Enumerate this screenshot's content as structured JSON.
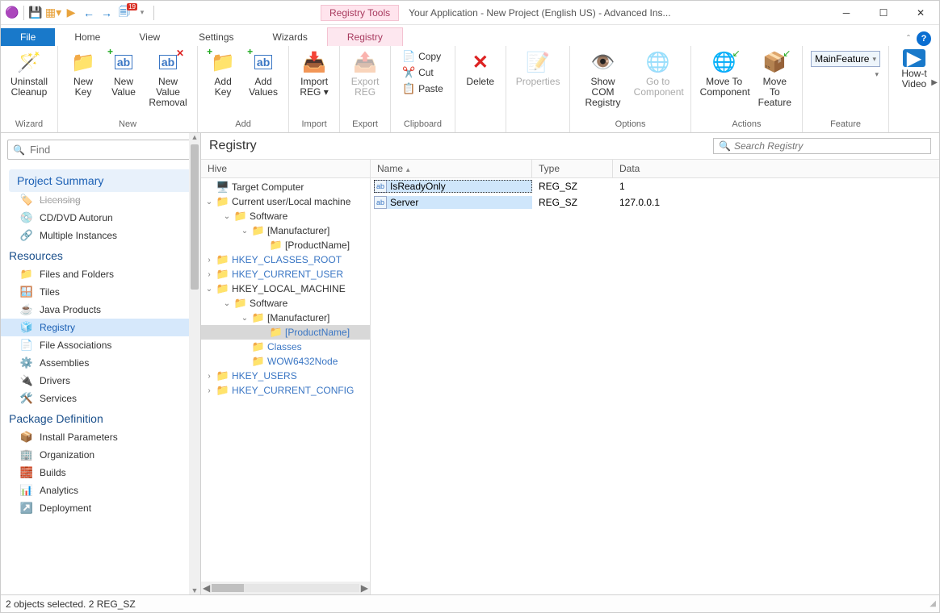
{
  "title": "Your Application - New Project (English US) - Advanced Ins...",
  "regtools_label": "Registry Tools",
  "qat_badge": "19",
  "tabs": [
    "File",
    "Home",
    "View",
    "Settings",
    "Wizards",
    "Registry"
  ],
  "ribbon": {
    "wizard": {
      "label": "Wizard",
      "uninstall": "Uninstall\nCleanup"
    },
    "new": {
      "label": "New",
      "key": "New\nKey",
      "value": "New\nValue",
      "removal": "New Value\nRemoval"
    },
    "add": {
      "label": "Add",
      "key": "Add\nKey",
      "values": "Add\nValues"
    },
    "import": {
      "label": "Import",
      "reg": "Import\nREG ▾"
    },
    "export": {
      "label": "Export",
      "reg": "Export\nREG"
    },
    "clipboard": {
      "label": "Clipboard",
      "copy": "Copy",
      "cut": "Cut",
      "paste": "Paste"
    },
    "delete": "Delete",
    "properties": "Properties",
    "options": {
      "label": "Options",
      "showcom": "Show COM\nRegistry",
      "goto": "Go to\nComponent"
    },
    "actions": {
      "label": "Actions",
      "movecomp": "Move To\nComponent",
      "movefeat": "Move To\nFeature"
    },
    "feature": {
      "label": "Feature",
      "value": "MainFeature"
    },
    "howto": "How-t\nVideo"
  },
  "find_placeholder": "Find",
  "nav": {
    "project_summary": "Project Summary",
    "licensing": "Licensing",
    "items1": [
      "CD/DVD Autorun",
      "Multiple Instances"
    ],
    "resources_hdr": "Resources",
    "resources": [
      "Files and Folders",
      "Tiles",
      "Java Products",
      "Registry",
      "File Associations",
      "Assemblies",
      "Drivers",
      "Services"
    ],
    "pkgdef_hdr": "Package Definition",
    "pkgdef": [
      "Install Parameters",
      "Organization",
      "Builds",
      "Analytics",
      "Deployment"
    ]
  },
  "content": {
    "title": "Registry",
    "search_placeholder": "Search Registry",
    "hive_label": "Hive",
    "cols": [
      "Name",
      "Type",
      "Data"
    ],
    "tree": [
      {
        "d": 0,
        "exp": "",
        "ico": "pc",
        "txt": "Target Computer"
      },
      {
        "d": 0,
        "exp": "v",
        "ico": "fld",
        "txt": "Current user/Local machine"
      },
      {
        "d": 1,
        "exp": "v",
        "ico": "fld",
        "txt": "Software"
      },
      {
        "d": 2,
        "exp": "v",
        "ico": "fld",
        "txt": "[Manufacturer]"
      },
      {
        "d": 3,
        "exp": "",
        "ico": "fld",
        "txt": "[ProductName]"
      },
      {
        "d": 0,
        "exp": ">",
        "ico": "fld",
        "txt": "HKEY_CLASSES_ROOT",
        "link": true
      },
      {
        "d": 0,
        "exp": ">",
        "ico": "fld",
        "txt": "HKEY_CURRENT_USER",
        "link": true
      },
      {
        "d": 0,
        "exp": "v",
        "ico": "fld",
        "txt": "HKEY_LOCAL_MACHINE"
      },
      {
        "d": 1,
        "exp": "v",
        "ico": "fld",
        "txt": "Software"
      },
      {
        "d": 2,
        "exp": "v",
        "ico": "fld",
        "txt": "[Manufacturer]"
      },
      {
        "d": 3,
        "exp": "",
        "ico": "fld",
        "txt": "[ProductName]",
        "sel": true,
        "link": true
      },
      {
        "d": 2,
        "exp": "",
        "ico": "fld",
        "txt": "Classes",
        "link": true
      },
      {
        "d": 2,
        "exp": "",
        "ico": "fld",
        "txt": "WOW6432Node",
        "link": true
      },
      {
        "d": 0,
        "exp": ">",
        "ico": "fld",
        "txt": "HKEY_USERS",
        "link": true
      },
      {
        "d": 0,
        "exp": ">",
        "ico": "fld",
        "txt": "HKEY_CURRENT_CONFIG",
        "link": true
      }
    ],
    "rows": [
      {
        "name": "IsReadyOnly",
        "type": "REG_SZ",
        "data": "1",
        "focus": true
      },
      {
        "name": "Server",
        "type": "REG_SZ",
        "data": "127.0.0.1"
      }
    ]
  },
  "status": "2 objects selected.  2 REG_SZ"
}
